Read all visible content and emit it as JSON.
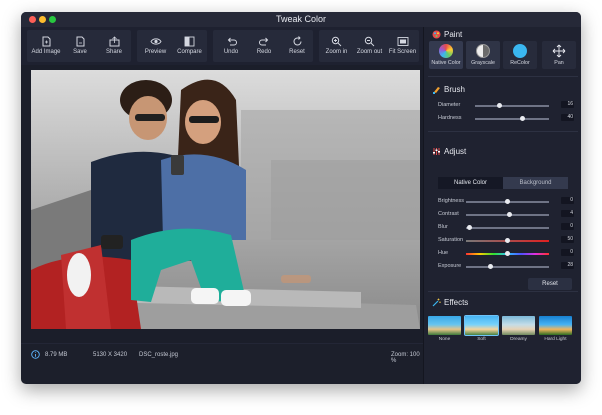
{
  "window": {
    "title": "Tweak Color"
  },
  "toolbar": {
    "buttons": [
      {
        "label": "Add Image",
        "icon": "document-plus-icon"
      },
      {
        "label": "Save",
        "icon": "save-icon"
      },
      {
        "label": "Share",
        "icon": "share-icon"
      },
      {
        "label": "Preview",
        "icon": "eye-icon"
      },
      {
        "label": "Compare",
        "icon": "compare-icon"
      },
      {
        "label": "Undo",
        "icon": "undo-icon"
      },
      {
        "label": "Redo",
        "icon": "redo-icon"
      },
      {
        "label": "Reset",
        "icon": "reset-icon"
      },
      {
        "label": "Zoom in",
        "icon": "zoom-in-icon"
      },
      {
        "label": "Zoom out",
        "icon": "zoom-out-icon"
      },
      {
        "label": "Fit Screen",
        "icon": "fit-screen-icon"
      }
    ]
  },
  "status": {
    "file_size": "8.79 MB",
    "dimensions": "5130 X 3420",
    "file_name": "DSC_roste.jpg",
    "zoom": "Zoom: 100 %"
  },
  "paint": {
    "title": "Paint",
    "buttons": [
      {
        "label": "Native Color",
        "color": "#e54b4b"
      },
      {
        "label": "Grayscale",
        "color": "#9a9a9a"
      },
      {
        "label": "ReColor",
        "color": "#3ab7f0"
      },
      {
        "label": "Pan",
        "color": "#ffffff"
      }
    ]
  },
  "brush": {
    "title": "Brush",
    "diameter": {
      "label": "Diameter",
      "value": "16",
      "fraction": 0.3
    },
    "hardness": {
      "label": "Hardness",
      "value": "40",
      "fraction": 0.5
    }
  },
  "adjust": {
    "title": "Adjust",
    "tabs": [
      "Native Color",
      "Background"
    ],
    "sliders": [
      {
        "label": "Brightness",
        "value": "0",
        "fraction": 0.5
      },
      {
        "label": "Contrast",
        "value": "4",
        "fraction": 0.52
      },
      {
        "label": "Blur",
        "value": "0",
        "fraction": 0.0
      },
      {
        "label": "Saturation",
        "value": "50",
        "fraction": 0.5
      },
      {
        "label": "Hue",
        "value": "0",
        "fraction": 0.5
      },
      {
        "label": "Exposure",
        "value": "28",
        "fraction": 0.3
      }
    ],
    "reset_label": "Reset"
  },
  "effects": {
    "title": "Effects",
    "items": [
      "None",
      "Soft",
      "Dreamy",
      "Hard Light"
    ],
    "selected": "Soft"
  }
}
